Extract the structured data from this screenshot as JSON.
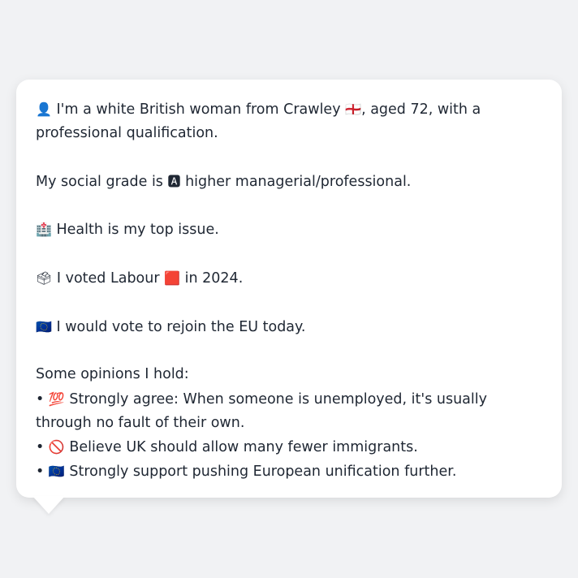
{
  "message": {
    "intro": {
      "icon": "👤",
      "text_before": "I'm a white British woman from Crawley",
      "flag": "🏴󠁧󠁢󠁥󠁮󠁧󠁿",
      "text_after": ", aged 72, with a professional qualification."
    },
    "social": {
      "text_before": "My social grade is",
      "icon": "🅰",
      "text_after": "higher managerial/professional."
    },
    "issue": {
      "icon": "🏥",
      "text": "Health is my top issue."
    },
    "vote": {
      "icon": "🗳",
      "text_before": "I voted Labour",
      "party_icon": "🟥",
      "text_after": "in 2024."
    },
    "eu": {
      "icon": "🇪🇺",
      "text": "I would vote to rejoin the EU today."
    },
    "opinions_heading": "Some opinions I hold:",
    "opinions": [
      {
        "bullet": "•",
        "icon": "💯",
        "text": "Strongly agree: When someone is unemployed, it's usually through no fault of their own."
      },
      {
        "bullet": "•",
        "icon": "🚫",
        "text": "Believe UK should allow many fewer immigrants."
      },
      {
        "bullet": "•",
        "icon": "🇪🇺",
        "text": "Strongly support pushing European unification further."
      }
    ]
  },
  "icons": {
    "person": "person-icon",
    "england_flag": "england-flag-icon",
    "grade_a": "grade-a-icon",
    "hospital": "hospital-icon",
    "ballot": "ballot-box-icon",
    "red_square": "red-square-icon",
    "eu_flag": "eu-flag-icon",
    "hundred": "hundred-points-icon",
    "prohibited": "prohibited-icon"
  }
}
